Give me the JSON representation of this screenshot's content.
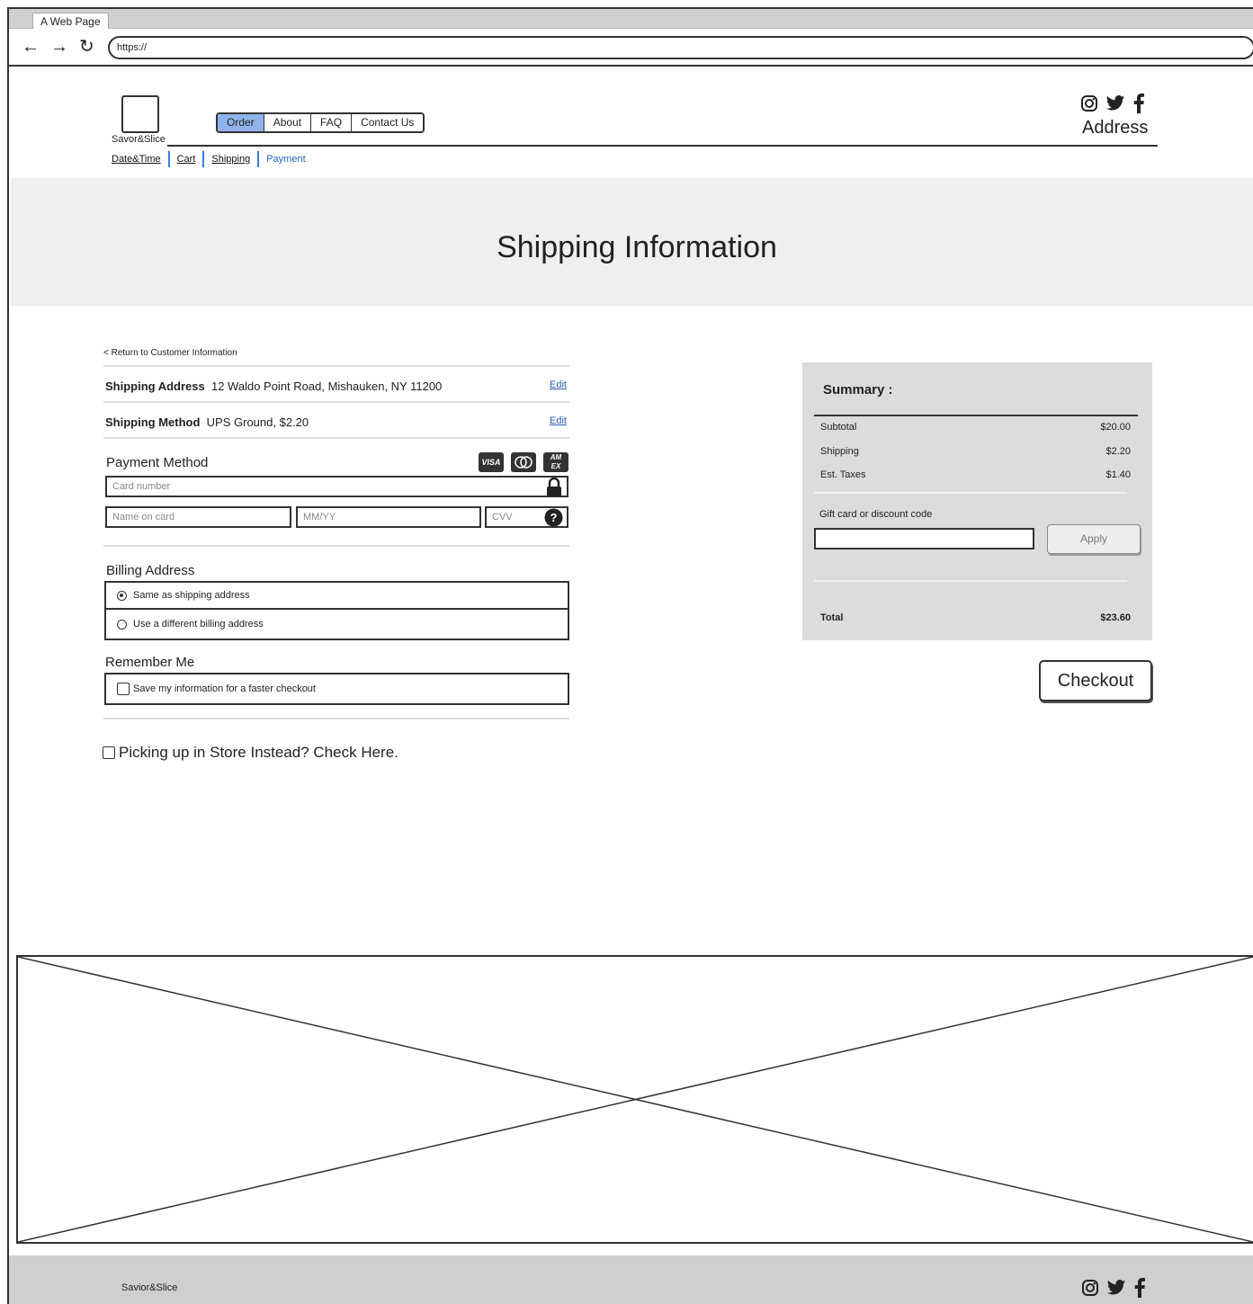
{
  "browser": {
    "tab_title": "A Web Page",
    "url": "https://"
  },
  "brand": {
    "name": "Savor&Slice"
  },
  "nav": {
    "items": [
      "Order",
      "About",
      "FAQ",
      "Contact Us"
    ],
    "active": "Order"
  },
  "header": {
    "address_label": "Address"
  },
  "breadcrumbs": [
    "Date&Time",
    "Cart",
    "Shipping",
    "Payment"
  ],
  "page": {
    "title": "Shipping Information"
  },
  "checkout_form": {
    "return_link": "< Return to Customer Information",
    "shipping_address": {
      "label": "Shipping Address",
      "value": "12 Waldo Point Road, Mishauken, NY 11200",
      "edit": "Edit"
    },
    "shipping_method": {
      "label": "Shipping Method",
      "value": "UPS Ground, $2.20",
      "edit": "Edit"
    },
    "payment": {
      "title": "Payment Method",
      "card_icons": [
        "visa-icon",
        "mastercard-icon",
        "amex-icon"
      ],
      "card_number_placeholder": "Card number",
      "name_placeholder": "Name on card",
      "expiry_placeholder": "MM/YY",
      "cvv_placeholder": "CVV"
    },
    "billing": {
      "title": "Billing Address",
      "options": [
        "Same as shipping address",
        "Use a different billing address"
      ],
      "selected": 0
    },
    "remember": {
      "title": "Remember Me",
      "checkbox_label": "Save my information for a faster checkout"
    },
    "pickup_label": "Picking up in Store Instead? Check Here."
  },
  "summary": {
    "title": "Summary :",
    "rows": [
      {
        "label": "Subtotal",
        "value": "$20.00"
      },
      {
        "label": "Shipping",
        "value": "$2.20"
      },
      {
        "label": "Est. Taxes",
        "value": "$1.40"
      }
    ],
    "gift_label": "Gift card or discount code",
    "apply_label": "Apply",
    "total_label": "Total",
    "total_value": "$23.60"
  },
  "checkout_button": "Checkout",
  "footer": {
    "brand": "Savior&Slice"
  },
  "colors": {
    "nav_active": "#8fb4ec",
    "link_blue": "#2766c4",
    "hero_bg": "#efefef",
    "summary_bg": "#dcdcdc",
    "footer_bg": "#cfcfcf"
  }
}
